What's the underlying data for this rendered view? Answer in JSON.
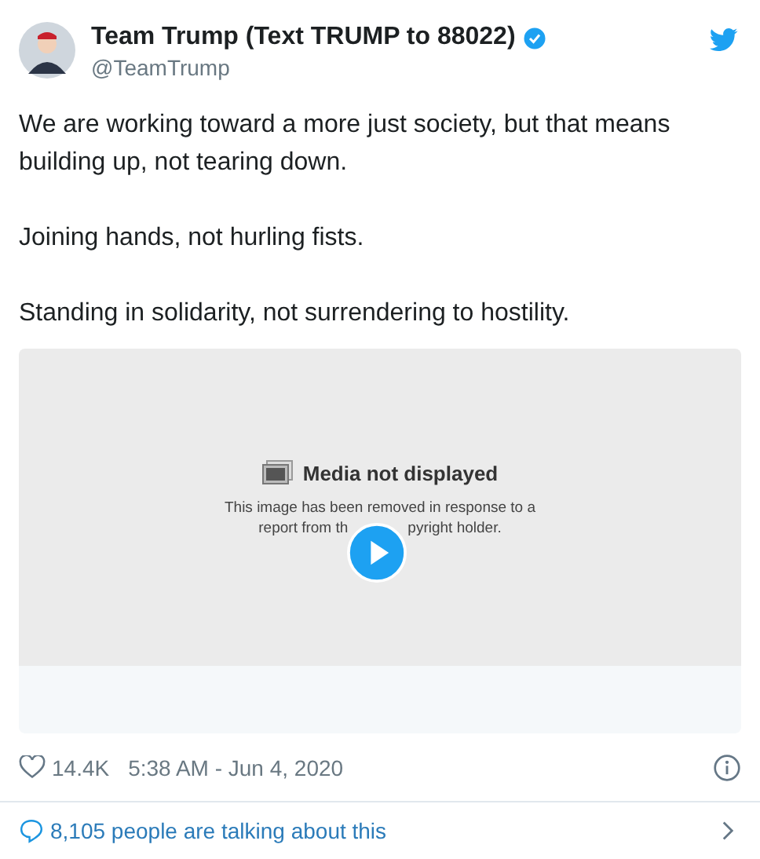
{
  "author": {
    "name": "Team Trump (Text TRUMP to 88022)",
    "verified": true,
    "handle": "@TeamTrump"
  },
  "paragraphs": [
    "We are working toward a more just society, but that means building up, not tearing down.",
    "Joining hands, not hurling fists.",
    "Standing in solidarity, not surrendering to hostility."
  ],
  "media": {
    "title": "Media not displayed",
    "message_lines": [
      [
        "This image has been removed in response to a"
      ],
      [
        "report from th",
        "pyright holder."
      ]
    ]
  },
  "likes": "14.4K",
  "timestamp": "5:38 AM - Jun 4, 2020",
  "conversation": "8,105 people are talking about this"
}
